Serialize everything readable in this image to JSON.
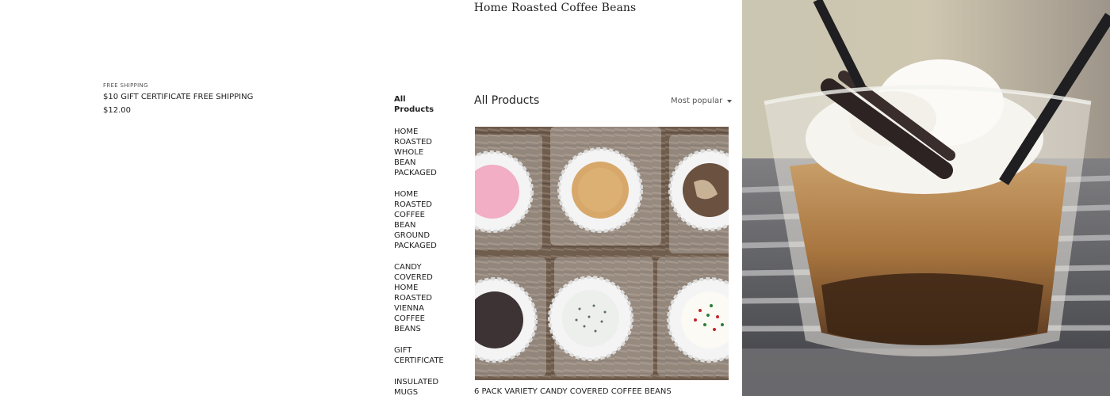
{
  "header": {
    "store_title": "Home Roasted Coffee Beans"
  },
  "featured": {
    "kicker": "FREE SHIPPING",
    "name": "$10 GIFT CERTIFICATE FREE SHIPPING",
    "price": "$12.00"
  },
  "sidebar": {
    "categories": [
      {
        "label": "All Products",
        "active": true
      },
      {
        "label": "HOME ROASTED WHOLE BEAN PACKAGED",
        "active": false
      },
      {
        "label": "HOME ROASTED COFFEE BEAN GROUND PACKAGED",
        "active": false
      },
      {
        "label": "CANDY COVERED HOME ROASTED VIENNA COFFEE BEANS",
        "active": false
      },
      {
        "label": "GIFT CERTIFICATE",
        "active": false
      },
      {
        "label": "INSULATED MUGS",
        "active": false
      }
    ]
  },
  "main": {
    "heading": "All Products",
    "sort_label": "Most popular",
    "products": [
      {
        "name": "6 PACK VARIETY CANDY COVERED COFFEE BEANS"
      }
    ]
  }
}
